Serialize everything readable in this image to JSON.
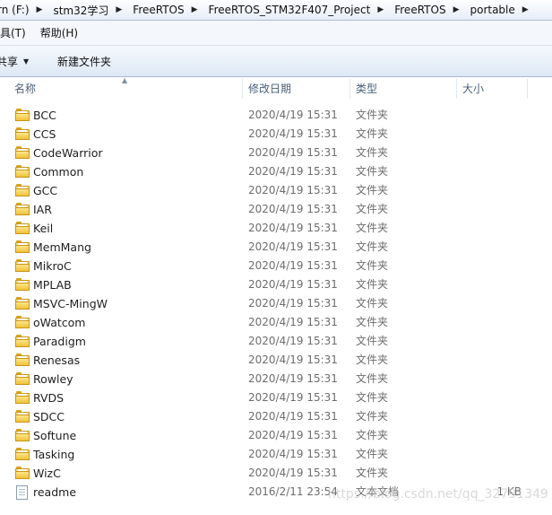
{
  "address": {
    "crumbs": [
      "rn (F:)",
      "stm32学习",
      "FreeRTOS",
      "FreeRTOS_STM32F407_Project",
      "FreeRTOS",
      "portable"
    ]
  },
  "menu": {
    "items": [
      "具(T)",
      "帮助(H)"
    ]
  },
  "toolbar": {
    "share_label": "共享",
    "new_folder_label": "新建文件夹"
  },
  "columns": {
    "name": "名称",
    "date": "修改日期",
    "type": "类型",
    "size": "大小"
  },
  "files": [
    {
      "name": "BCC",
      "date": "2020/4/19 15:31",
      "type": "文件夹",
      "size": "",
      "icon": "folder-icon"
    },
    {
      "name": "CCS",
      "date": "2020/4/19 15:31",
      "type": "文件夹",
      "size": "",
      "icon": "folder-icon"
    },
    {
      "name": "CodeWarrior",
      "date": "2020/4/19 15:31",
      "type": "文件夹",
      "size": "",
      "icon": "folder-icon"
    },
    {
      "name": "Common",
      "date": "2020/4/19 15:31",
      "type": "文件夹",
      "size": "",
      "icon": "folder-icon"
    },
    {
      "name": "GCC",
      "date": "2020/4/19 15:31",
      "type": "文件夹",
      "size": "",
      "icon": "folder-icon"
    },
    {
      "name": "IAR",
      "date": "2020/4/19 15:31",
      "type": "文件夹",
      "size": "",
      "icon": "folder-icon"
    },
    {
      "name": "Keil",
      "date": "2020/4/19 15:31",
      "type": "文件夹",
      "size": "",
      "icon": "folder-icon"
    },
    {
      "name": "MemMang",
      "date": "2020/4/19 15:31",
      "type": "文件夹",
      "size": "",
      "icon": "folder-icon"
    },
    {
      "name": "MikroC",
      "date": "2020/4/19 15:31",
      "type": "文件夹",
      "size": "",
      "icon": "folder-icon"
    },
    {
      "name": "MPLAB",
      "date": "2020/4/19 15:31",
      "type": "文件夹",
      "size": "",
      "icon": "folder-icon"
    },
    {
      "name": "MSVC-MingW",
      "date": "2020/4/19 15:31",
      "type": "文件夹",
      "size": "",
      "icon": "folder-icon"
    },
    {
      "name": "oWatcom",
      "date": "2020/4/19 15:31",
      "type": "文件夹",
      "size": "",
      "icon": "folder-icon"
    },
    {
      "name": "Paradigm",
      "date": "2020/4/19 15:31",
      "type": "文件夹",
      "size": "",
      "icon": "folder-icon"
    },
    {
      "name": "Renesas",
      "date": "2020/4/19 15:31",
      "type": "文件夹",
      "size": "",
      "icon": "folder-icon"
    },
    {
      "name": "Rowley",
      "date": "2020/4/19 15:31",
      "type": "文件夹",
      "size": "",
      "icon": "folder-icon"
    },
    {
      "name": "RVDS",
      "date": "2020/4/19 15:31",
      "type": "文件夹",
      "size": "",
      "icon": "folder-icon"
    },
    {
      "name": "SDCC",
      "date": "2020/4/19 15:31",
      "type": "文件夹",
      "size": "",
      "icon": "folder-icon"
    },
    {
      "name": "Softune",
      "date": "2020/4/19 15:31",
      "type": "文件夹",
      "size": "",
      "icon": "folder-icon"
    },
    {
      "name": "Tasking",
      "date": "2020/4/19 15:31",
      "type": "文件夹",
      "size": "",
      "icon": "folder-icon"
    },
    {
      "name": "WizC",
      "date": "2020/4/19 15:31",
      "type": "文件夹",
      "size": "",
      "icon": "folder-icon"
    },
    {
      "name": "readme",
      "date": "2016/2/11 23:54",
      "type": "文本文档",
      "size": "1 KB",
      "icon": "text-file-icon"
    }
  ],
  "watermark": "https://blog.csdn.net/qq_32791349"
}
